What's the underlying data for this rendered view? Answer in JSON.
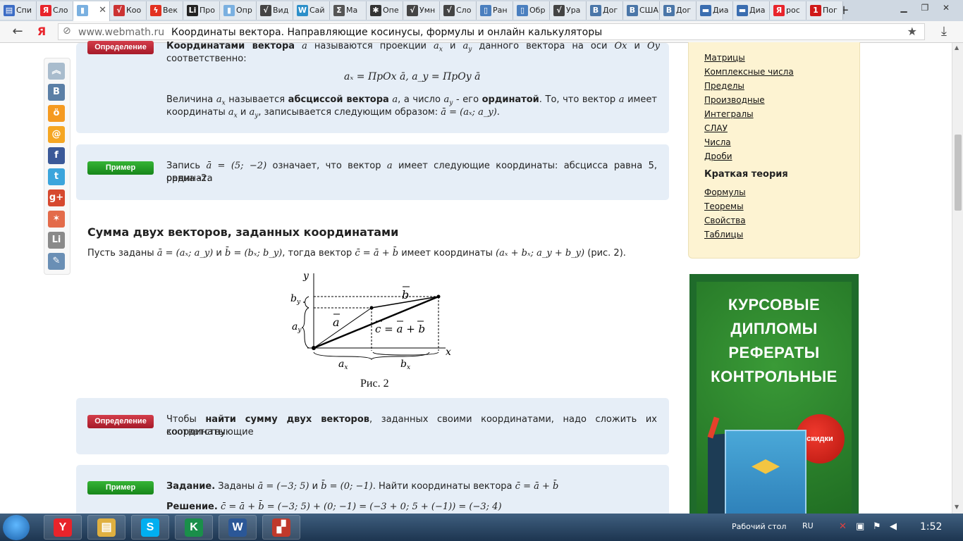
{
  "browser": {
    "tabs": [
      {
        "label": "Спи",
        "icon": "doc-icon",
        "color": "#3b6cc5",
        "glyph": "▤"
      },
      {
        "label": "Сло",
        "icon": "yandex-icon",
        "color": "#e8242b",
        "glyph": "Я"
      },
      {
        "label": "",
        "icon": "page-icon",
        "color": "#7ab0e0",
        "glyph": "▮",
        "active": true
      },
      {
        "label": "Коо",
        "icon": "sqrt-icon",
        "color": "#c33",
        "glyph": "√"
      },
      {
        "label": "Век",
        "icon": "lightning-icon",
        "color": "#e23020",
        "glyph": "ϟ"
      },
      {
        "label": "Про",
        "icon": "li-icon",
        "color": "#222",
        "glyph": "Li"
      },
      {
        "label": "Опр",
        "icon": "page-icon",
        "color": "#7ab0e0",
        "glyph": "▮"
      },
      {
        "label": "Вид",
        "icon": "sqrt-icon",
        "color": "#444",
        "glyph": "√"
      },
      {
        "label": "Сай",
        "icon": "wordpress-icon",
        "color": "#2c8fc9",
        "glyph": "W"
      },
      {
        "label": "Ма",
        "icon": "sigma-icon",
        "color": "#555",
        "glyph": "Σ"
      },
      {
        "label": "Опе",
        "icon": "flower-icon",
        "color": "#333",
        "glyph": "✱"
      },
      {
        "label": "Умн",
        "icon": "sqrt-icon",
        "color": "#444",
        "glyph": "√"
      },
      {
        "label": "Сло",
        "icon": "sqrt-icon",
        "color": "#444",
        "glyph": "√"
      },
      {
        "label": "Ран",
        "icon": "book-icon",
        "color": "#4a7fbf",
        "glyph": "▯"
      },
      {
        "label": "Обр",
        "icon": "book-icon",
        "color": "#4a7fbf",
        "glyph": "▯"
      },
      {
        "label": "Ура",
        "icon": "sqrt-icon",
        "color": "#444",
        "glyph": "√"
      },
      {
        "label": "Дог",
        "icon": "vk-icon",
        "color": "#4a76a8",
        "glyph": "B"
      },
      {
        "label": "США",
        "icon": "vk-icon",
        "color": "#4a76a8",
        "glyph": "B"
      },
      {
        "label": "Дог",
        "icon": "vk-icon",
        "color": "#4a76a8",
        "glyph": "B"
      },
      {
        "label": "Диа",
        "icon": "chat-icon",
        "color": "#3a6db0",
        "glyph": "▬"
      },
      {
        "label": "Диа",
        "icon": "chat-icon",
        "color": "#3a6db0",
        "glyph": "▬"
      },
      {
        "label": "рос",
        "icon": "yandex-icon",
        "color": "#e8242b",
        "glyph": "Я"
      },
      {
        "label": "Пог",
        "icon": "channel-one-icon",
        "color": "#d01818",
        "glyph": "1"
      }
    ],
    "address": {
      "host": "www.webmath.ru",
      "title": "Координаты вектора. Направляющие косинусы, формулы и онлайн калькуляторы"
    }
  },
  "share_buttons": [
    {
      "name": "scroll-up-icon",
      "color": "#a9bccd",
      "glyph": "︽"
    },
    {
      "name": "vk-share-icon",
      "color": "#5b7fa6",
      "glyph": "B"
    },
    {
      "name": "odnoklassniki-icon",
      "color": "#f59a21",
      "glyph": "ö"
    },
    {
      "name": "mail-ru-icon",
      "color": "#f5a623",
      "glyph": "@"
    },
    {
      "name": "facebook-icon",
      "color": "#3b5998",
      "glyph": "f"
    },
    {
      "name": "twitter-icon",
      "color": "#3ca5dc",
      "glyph": "t"
    },
    {
      "name": "google-plus-icon",
      "color": "#d6492f",
      "glyph": "g+"
    },
    {
      "name": "moikrug-icon",
      "color": "#e36b4a",
      "glyph": "✶"
    },
    {
      "name": "liveinternet-icon",
      "color": "#8a8a8a",
      "glyph": "Li"
    },
    {
      "name": "livejournal-icon",
      "color": "#6a8fb5",
      "glyph": "✎"
    }
  ],
  "content": {
    "def1": {
      "badge": "Определение",
      "bold1": "Координатами вектора",
      "t1": "называются проекции",
      "t2": "и",
      "t3": "данного вектора на оси",
      "t4": "и",
      "t5": "соответственно:",
      "m_a": "a",
      "m_ax": "a",
      "m_ay": "a",
      "m_ox": "Ox",
      "m_oy": "Oy",
      "formula": "aₓ = ПрOx ā, a_y = ПрOy ā",
      "p2_t1": "Величина",
      "p2_t2": "называется",
      "p2_bold1": "абсциссой вектора",
      "p2_t3": ", а число",
      "p2_t4": "- его",
      "p2_bold2": "ординатой",
      "p2_t5": ". То, что вектор",
      "p2_t6": "имеет",
      "p2_line2_t1": "координаты",
      "p2_line2_t2": "и",
      "p2_line2_t3": ", записывается следующим образом:",
      "p2_line2_m": "ā = (aₓ; a_y)."
    },
    "example1": {
      "badge": "Пример",
      "t1": "Запись",
      "m1": "ā = (5; −2)",
      "t2": "означает, что вектор",
      "t3": "имеет следующие координаты: абсцисса равна 5, ордината",
      "t4": "равна -2."
    },
    "section_title": "Сумма двух векторов, заданных координатами",
    "intro": {
      "t1": "Пусть заданы",
      "m1": "ā = (aₓ; a_y)",
      "t2": "и",
      "m2": "b̄ = (bₓ; b_y)",
      "t3": ", тогда вектор",
      "m3": "c̄ = ā + b̄",
      "t4": "имеет координаты",
      "m4": "(aₓ + bₓ; a_y + b_y)",
      "t5": "(рис. 2)."
    },
    "figure": {
      "caption": "Рис. 2",
      "label_y": "y",
      "label_x": "x",
      "label_by": "b",
      "label_ay": "a",
      "label_ax": "a",
      "label_bx": "b",
      "label_a": "a",
      "label_b": "b",
      "label_c": "c = a + b",
      "sub_x": "x",
      "sub_y": "y"
    },
    "def2": {
      "badge": "Определение",
      "t1": "Чтобы",
      "bold1": "найти сумму двух векторов",
      "t2": ", заданных своими координатами, надо сложить их соответствующие",
      "t3": "координаты."
    },
    "example2": {
      "badge": "Пример",
      "bold1": "Задание.",
      "t1": "Заданы",
      "m1": "ā = (−3; 5)",
      "t2": "и",
      "m2": "b̄ = (0; −1)",
      "t3": ". Найти координаты вектора",
      "m3": "c̄ = ā + b̄",
      "bold2": "Решение.",
      "m4": "c̄ = ā + b̄ = (−3; 5) + (0; −1) = (−3 + 0; 5 + (−1)) = (−3; 4)"
    }
  },
  "sidebar": {
    "links1": [
      "Матрицы",
      "Комплексные числа",
      "Пределы",
      "Производные",
      "Интегралы",
      "СЛАУ",
      "Числа",
      "Дроби"
    ],
    "heading": "Краткая теория",
    "links2": [
      "Формулы",
      "Теоремы",
      "Свойства",
      "Таблицы"
    ]
  },
  "ad": {
    "lines": [
      "КУРСОВЫЕ",
      "ДИПЛОМЫ",
      "РЕФЕРАТЫ",
      "КОНТРОЛЬНЫЕ"
    ],
    "sale": "скидки"
  },
  "taskbar": {
    "apps": [
      {
        "name": "yandex-browser-taskbar-icon",
        "color": "#e8242b",
        "glyph": "Y"
      },
      {
        "name": "explorer-taskbar-icon",
        "color": "#e0b040",
        "glyph": "▤"
      },
      {
        "name": "skype-taskbar-icon",
        "color": "#00aff0",
        "glyph": "S"
      },
      {
        "name": "kaspersky-taskbar-icon",
        "color": "#1a8f4a",
        "glyph": "K"
      },
      {
        "name": "word-taskbar-icon",
        "color": "#2b5797",
        "glyph": "W"
      },
      {
        "name": "pdf-taskbar-icon",
        "color": "#c0392b",
        "glyph": "▞"
      }
    ],
    "desktop_label": "Рабочий стол",
    "lang": "RU",
    "clock": "1:52"
  }
}
